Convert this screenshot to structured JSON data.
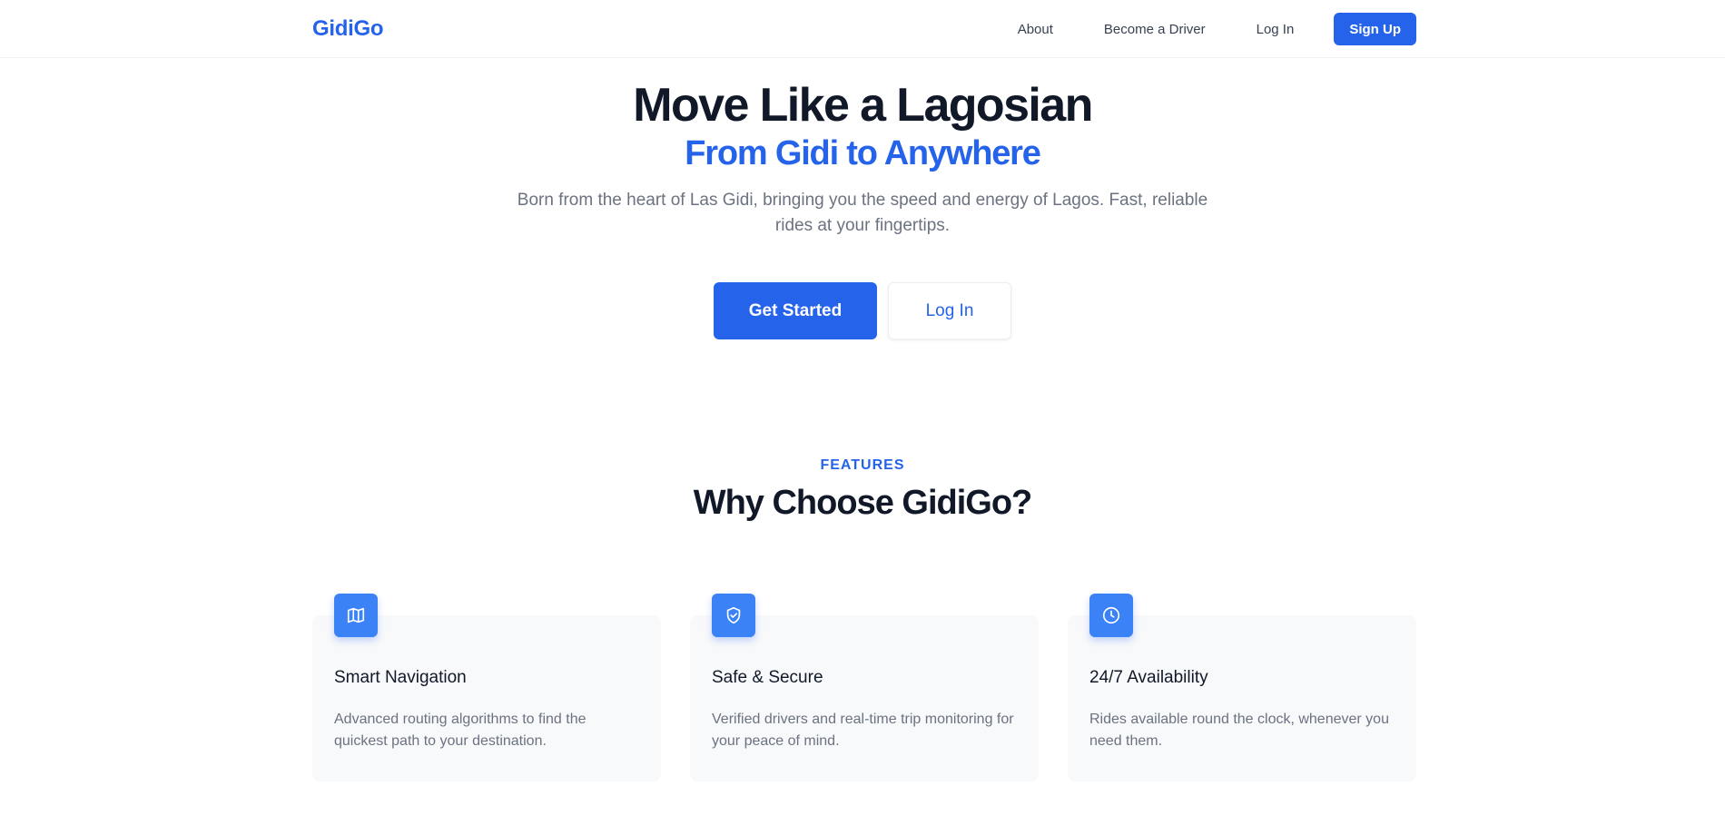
{
  "nav": {
    "logo": "GidiGo",
    "links": [
      "About",
      "Become a Driver",
      "Log In"
    ],
    "signup": "Sign Up"
  },
  "hero": {
    "title": "Move Like a Lagosian",
    "subtitle": "From Gidi to Anywhere",
    "description": "Born from the heart of Las Gidi, bringing you the speed and energy of Lagos. Fast, reliable rides at your fingertips.",
    "primary_cta": "Get Started",
    "secondary_cta": "Log In"
  },
  "features": {
    "eyebrow": "FEATURES",
    "title": "Why Choose GidiGo?",
    "cards": [
      {
        "icon": "map-icon",
        "title": "Smart Navigation",
        "description": "Advanced routing algorithms to find the quickest path to your destination."
      },
      {
        "icon": "shield-check-icon",
        "title": "Safe & Secure",
        "description": "Verified drivers and real-time trip monitoring for your peace of mind."
      },
      {
        "icon": "clock-icon",
        "title": "24/7 Availability",
        "description": "Rides available round the clock, whenever you need them."
      }
    ]
  },
  "colors": {
    "brand": "#2563eb",
    "icon_bg": "#3b82f6",
    "heading": "#111827",
    "muted": "#6b7280",
    "card_bg": "#f8f9fb"
  }
}
